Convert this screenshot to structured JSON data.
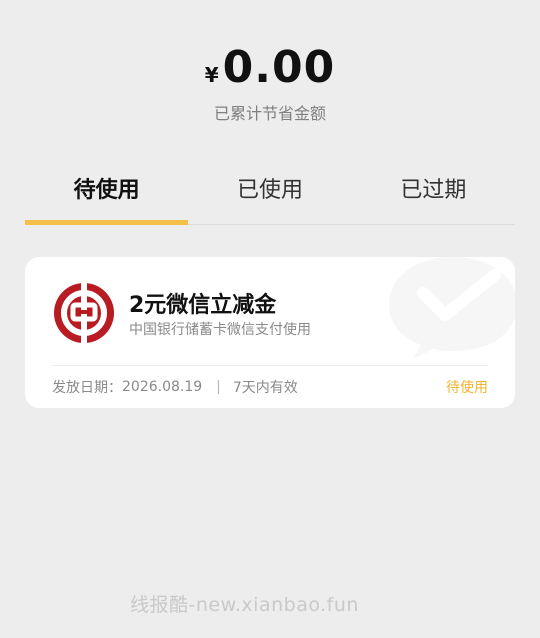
{
  "savings": {
    "currency": "¥",
    "amount": "0.00",
    "label": "已累计节省金额"
  },
  "tabs": [
    {
      "label": "待使用",
      "active": true
    },
    {
      "label": "已使用",
      "active": false
    },
    {
      "label": "已过期",
      "active": false
    }
  ],
  "coupon": {
    "logo_icon": "bank-of-china-logo",
    "title": "2元微信立减金",
    "description": "中国银行储蓄卡微信支付使用",
    "issue_date_label": "发放日期：",
    "issue_date": "2026.08.19",
    "separator": "|",
    "validity": "7天内有效",
    "status": "待使用"
  },
  "watermark": "线报酷-new.xianbao.fun",
  "colors": {
    "accent": "#f5c04a",
    "status": "#f0b430",
    "bank_red": "#b81c22",
    "background": "#ededed"
  }
}
